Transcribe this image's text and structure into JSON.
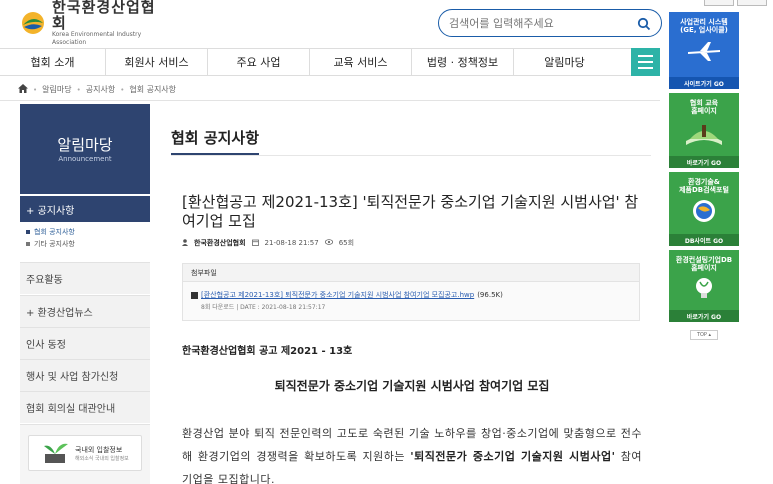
{
  "header": {
    "logo_ko": "한국환경산업협회",
    "logo_en": "Korea Environmental Industry Association",
    "search_placeholder": "검색어를 입력해주세요"
  },
  "gnb": {
    "items": [
      {
        "label": "협회 소개"
      },
      {
        "label": "회원사 서비스"
      },
      {
        "label": "주요 사업"
      },
      {
        "label": "교육 서비스"
      },
      {
        "label": "법령 · 정책정보"
      },
      {
        "label": "알림마당"
      }
    ]
  },
  "breadcrumb": {
    "items": [
      "알림마당",
      "공지사항",
      "협회 공지사항"
    ]
  },
  "sidebar": {
    "title": "알림마당",
    "subtitle": "Announcement",
    "active": "+ 공지사항",
    "sub_items": [
      "협회 공지사항",
      "기타 공지사항"
    ],
    "items": [
      "주요활동",
      "+ 환경산업뉴스",
      "인사 동정",
      "행사 및 사업 참가신청",
      "협회 회의실 대관안내"
    ],
    "banner_title": "국내외 입찰정보",
    "banner_sub": "해외소식 국내외 입찰정보"
  },
  "content": {
    "page_title": "협회 공지사항",
    "post_title": "[환산협공고 제2021-13호] '퇴직전문가 중소기업 기술지원 시범사업' 참여기업 모집",
    "author": "한국환경산업협회",
    "date": "21-08-18 21:57",
    "views": "65회",
    "attach_head": "첨부파일",
    "attach_name": "[환산협공고 제2021-13호] 퇴직전문가 중소기업 기술지원 시범사업 참여기업 모집공고.hwp",
    "attach_size": "(96.5K)",
    "attach_info": "8회 다운로드 | DATE : 2021-08-18 21:57:17",
    "notice_no": "한국환경산업협회  공고  제2021 - 13호",
    "body_title": "퇴직전문가 중소기업 기술지원 시범사업 참여기업 모집",
    "body_part1": "환경산업 분야 퇴직 전문인력의 고도로 숙련된 기술 노하우를 창업·중소기업에 맞춤형으로 전수해 환경기업의 경쟁력을 확보하도록 지원하는 ",
    "body_bold": "'퇴직전문가 중소기업 기술지원 시범사업'",
    "body_part2": " 참여 기업을 모집합니다."
  },
  "right_banners": [
    {
      "title": "사업관리 시스템\n(GE, 업사이클)",
      "go": "사이트가기 GO"
    },
    {
      "title": "협회 교육\n홈페이지",
      "go": "바로가기 GO"
    },
    {
      "title": "환경기술&\n제품DB검색포털",
      "go": "DB사이트 GO"
    },
    {
      "title": "환경컨설팅기업DB\n홈페이지",
      "go": "바로가기 GO"
    }
  ],
  "top_button": "TOP ▴",
  "colors": {
    "navy": "#2e4470",
    "teal": "#2db3a7",
    "green": "#3ba34a",
    "blue": "#2a6ed0"
  }
}
